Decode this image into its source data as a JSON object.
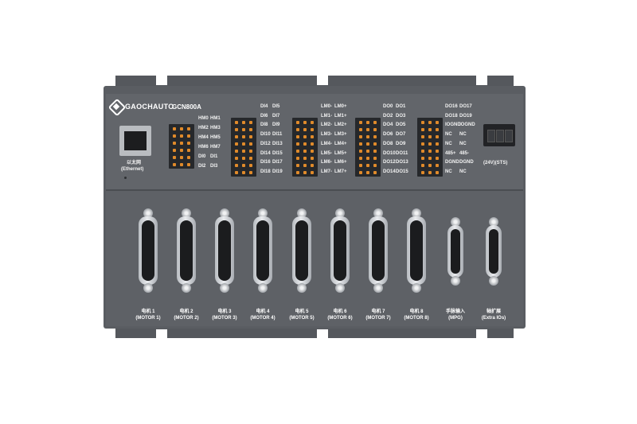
{
  "device": {
    "brand": "GAOCHAUTO",
    "model": "GCN800A",
    "colors": {
      "body": "#5a5d62",
      "terminal_pins": "#e08a2a"
    }
  },
  "ethernet": {
    "label_cn": "以太网",
    "label_en": "(Ethernet)"
  },
  "io_labels": {
    "hm_col1": [
      "HM0",
      "HM2",
      "HM4",
      "HM6",
      "DI0",
      "DI2"
    ],
    "hm_col2": [
      "HM1",
      "HM3",
      "HM5",
      "HM7",
      "DI1",
      "DI3"
    ],
    "di_col1": [
      "DI4",
      "DI6",
      "DI8",
      "DI10",
      "DI12",
      "DI14",
      "DI16",
      "DI18"
    ],
    "di_col2": [
      "DI5",
      "DI7",
      "DI9",
      "DI11",
      "DI13",
      "DI15",
      "DI17",
      "DI19"
    ],
    "lm_col1": [
      "LM0-",
      "LM1-",
      "LM2-",
      "LM3-",
      "LM4-",
      "LM5-",
      "LM6-",
      "LM7-"
    ],
    "lm_col2": [
      "LM0+",
      "LM1+",
      "LM2+",
      "LM3+",
      "LM4+",
      "LM5+",
      "LM6+",
      "LM7+"
    ],
    "do_col1": [
      "DO0",
      "DO2",
      "DO4",
      "DO6",
      "DO8",
      "DO10",
      "DO12",
      "DO14"
    ],
    "do_col2": [
      "DO1",
      "DO3",
      "DO5",
      "DO7",
      "DO9",
      "DO11",
      "DO13",
      "DO15"
    ],
    "misc_col1": [
      "DO16",
      "DO18",
      "IOGND",
      "NC",
      "NC",
      "485+",
      "DGND",
      "NC"
    ],
    "misc_col2": [
      "DO17",
      "DO19",
      "IOGND",
      "NC",
      "NC",
      "485-",
      "DGND",
      "NC"
    ]
  },
  "power": {
    "label": "(24V)(STS)"
  },
  "ports": [
    {
      "cn": "电机 1",
      "en": "(MOTOR 1)"
    },
    {
      "cn": "电机 2",
      "en": "(MOTOR 2)"
    },
    {
      "cn": "电机 3",
      "en": "(MOTOR 3)"
    },
    {
      "cn": "电机 4",
      "en": "(MOTOR 4)"
    },
    {
      "cn": "电机 5",
      "en": "(MOTOR 5)"
    },
    {
      "cn": "电机 6",
      "en": "(MOTOR 6)"
    },
    {
      "cn": "电机 7",
      "en": "(MOTOR 7)"
    },
    {
      "cn": "电机 8",
      "en": "(MOTOR 8)"
    },
    {
      "cn": "手脉输入",
      "en": "(MPG)"
    },
    {
      "cn": "轴扩展",
      "en": "(Extra IOs)"
    }
  ]
}
